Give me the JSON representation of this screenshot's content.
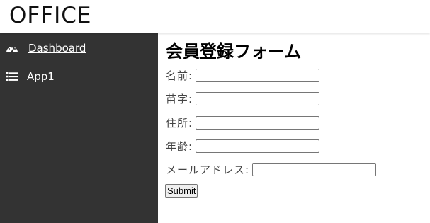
{
  "header": {
    "brand": "OFFICE"
  },
  "sidebar": {
    "items": [
      {
        "label": "Dashboard",
        "icon": "dashboard-gauge-icon"
      },
      {
        "label": "App1",
        "icon": "list-icon"
      }
    ]
  },
  "form": {
    "title": "会員登録フォーム",
    "fields": [
      {
        "label": "名前:",
        "value": ""
      },
      {
        "label": "苗字:",
        "value": ""
      },
      {
        "label": "住所:",
        "value": ""
      },
      {
        "label": "年齢:",
        "value": ""
      },
      {
        "label": "メールアドレス:",
        "value": ""
      }
    ],
    "submit_label": "Submit"
  },
  "colors": {
    "sidebar_bg": "#333333",
    "header_bg": "#ffffff",
    "text_light": "#ffffff"
  }
}
